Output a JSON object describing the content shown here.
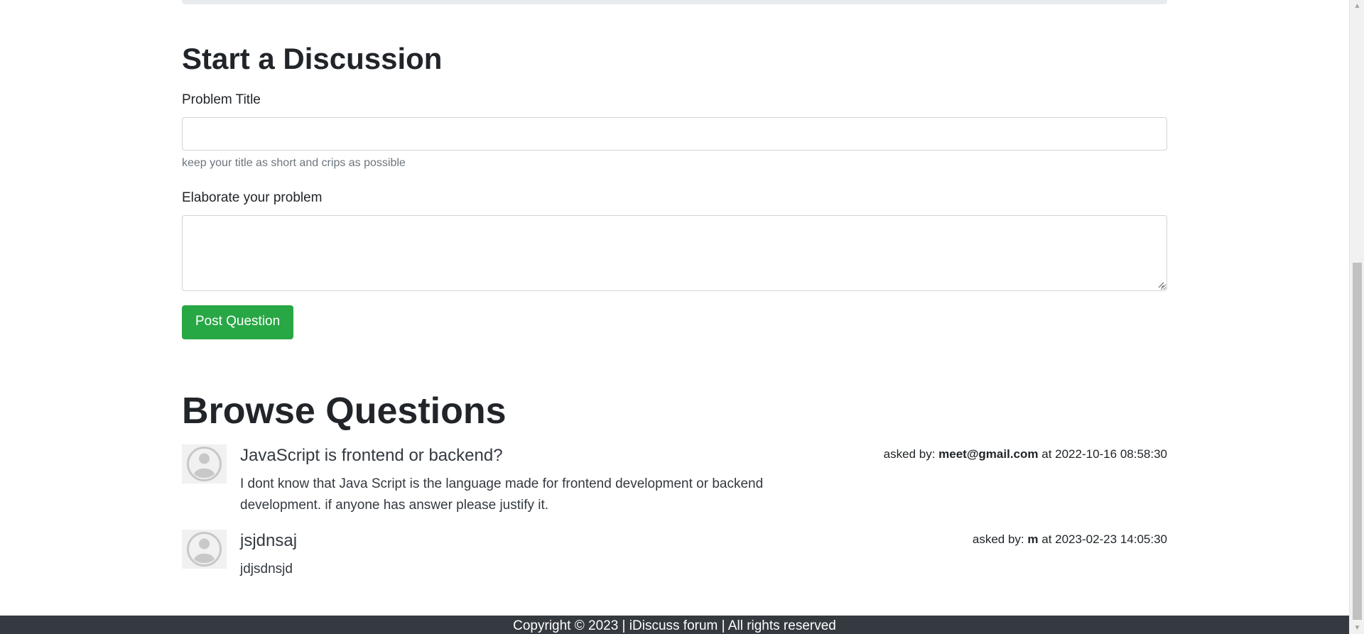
{
  "discussion_form": {
    "heading": "Start a Discussion",
    "title_label": "Problem Title",
    "title_value": "",
    "title_help": "keep your title as short and crips as possible",
    "desc_label": "Elaborate your problem",
    "desc_value": "",
    "submit_label": "Post Question"
  },
  "browse": {
    "heading": "Browse Questions",
    "questions": [
      {
        "title": "JavaScript is frontend or backend?",
        "description": "I dont know that Java Script is the language made for frontend development or backend development. if anyone has answer please justify it.",
        "asked_by_prefix": "asked by:",
        "user": "meet@gmail.com",
        "at_text": "at 2022-10-16 08:58:30"
      },
      {
        "title": "jsjdnsaj",
        "description": "jdjsdnsjd",
        "asked_by_prefix": "asked by:",
        "user": "m",
        "at_text": "at 2023-02-23 14:05:30"
      }
    ]
  },
  "footer": {
    "text": "Copyright © 2023 | iDiscuss forum | All rights reserved"
  },
  "colors": {
    "primary_button": "#28a745",
    "footer_bg": "#343a40",
    "muted_text": "#6c757d"
  },
  "icons": {
    "avatar": "user-avatar-icon",
    "scroll_up": "scroll-up-arrow-icon",
    "scroll_down": "scroll-down-arrow-icon",
    "resize": "resize-grip-icon"
  }
}
